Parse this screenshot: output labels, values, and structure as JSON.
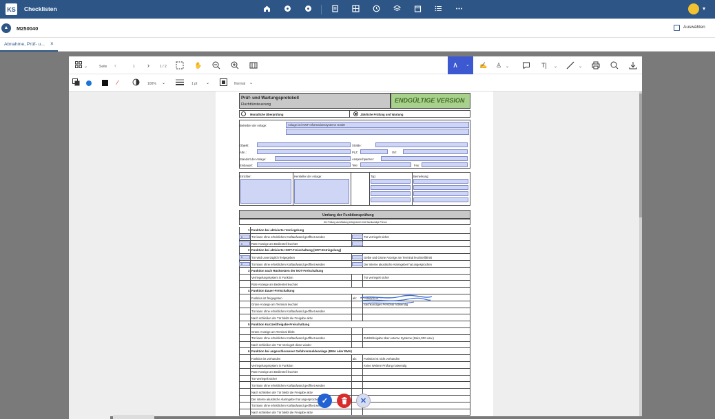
{
  "app": {
    "title": "Checklisten",
    "logo_text": "KS",
    "nav_icons": [
      "home-icon",
      "dot-icon",
      "dot-icon",
      "doc-icon",
      "grid-icon",
      "clock-icon",
      "layers-icon",
      "calendar-icon",
      "list-icon",
      "more-icon"
    ]
  },
  "record": {
    "id": "M250040",
    "select_label": "Auswählen"
  },
  "tabs": [
    {
      "label": "Abnahme, Prüf- u...",
      "close": "×"
    }
  ],
  "viewer": {
    "toolbar1": {
      "page_label": "Seite",
      "page_num": "1",
      "page_count": "1 / 2"
    },
    "toolbar2": {
      "zoom": "100%",
      "stroke": "1 pt",
      "blend": "Normal"
    }
  },
  "document": {
    "title": "Prüf- und Wartungsprotokoll",
    "subtitle": "Fluchttürsteuerung",
    "final_badge": "ENDGÜLTIGE VERSION",
    "check_monthly": "Monatliche Überprüfung",
    "check_yearly": "Jährliche Prüfung und Wartung",
    "operator_label": "Betreiber der Anlage:",
    "operator_value": "Anlage bei KWF Informationssysteme GmbH",
    "fields": {
      "object": "Objekt:",
      "street": "Straße:",
      "attn": "Attn.:",
      "zip": "PLZ:",
      "city": "Ort:",
      "location": "Standort der Anlage:",
      "contact": "Ansprechpartner:",
      "install": "Einbauort:",
      "phone": "Tele:",
      "fax": "Fax:",
      "installer": "Errichter:",
      "manufacturer": "Hersteller der Anlage:",
      "type": "Typ:",
      "remark": "Bemerkung:"
    },
    "section_title": "Umfang der Funktionsprüfung",
    "section_note": "Die Prüfung und Wartung erfolgt durch eine Sachkundige Person",
    "items": [
      {
        "num": "1",
        "title": "Funktion bei aktivierter Verriegelung"
      },
      {
        "text": "Tür kann ohne erheblichen Kraftaufwand geöffnet werden",
        "right": "Tür verriegelt sicher"
      },
      {
        "text": "Rote Anzeige am Bedienteil leuchtet"
      },
      {
        "num": "2",
        "title": "Funktion bei aktivierter NOT-Freischaltung (NOT-Entriegelung)"
      },
      {
        "text": "Tür wird unverzüglich freigegeben",
        "right": "Gelbe und Grüne Anzeige am Terminal leuchtet/blinkt"
      },
      {
        "text": "Tür kann ohne erheblichen Kraftaufwand geöffnet werden",
        "right": "Der interne akustische Alarmgeber hat angesprochen"
      },
      {
        "num": "3",
        "title": "Funktion nach Rücksetzen der NOT-Freischaltung"
      },
      {
        "text": "Verriegelungssystem in Funktion",
        "right": "Tür verriegelt sicher"
      },
      {
        "text": "Rote Anzeige am Bedienteil leuchtet"
      },
      {
        "num": "4",
        "title": "Funktion Dauer-Freischaltung"
      },
      {
        "text": "Funktion ist freigegeben",
        "mid": "ab:",
        "right": "Funktion ist ..."
      },
      {
        "text": "Grüne Anzeige am Terminal leuchtet",
        "right": "Sachkundiges Personal notwendig"
      },
      {
        "text": "Tür kann ohne erheblichen Kraftaufwand geöffnet werden"
      },
      {
        "text": "Nach schließen der Tür bleibt die Freigabe aktiv"
      },
      {
        "num": "5",
        "title": "Funktion Kurzzeitfreigabe-Freischaltung"
      },
      {
        "text": "Grüne Anzeige am Terminal blinkt"
      },
      {
        "text": "Tür kann ohne erheblichen Kraftaufwand geöffnet werden",
        "right": "Zutrittsfreigabe über externe Systeme (Zako,SPA usw.)"
      },
      {
        "text": "Nach schließen der Tür Verriegelt diese wieder"
      },
      {
        "num": "6",
        "title": "Funktion bei angeschlossener Gefahrenmeldeanlage (BMA oder EMA)"
      },
      {
        "text": "Funktion ist vorhanden",
        "mid": "ab:",
        "right": "Funktion ist nicht vorhanden"
      },
      {
        "text": "Verriegelungssystem in Funktion",
        "right": "Keine Weitere Prüfung notwendig"
      },
      {
        "text": "Rote Anzeige am Bedienteil leuchtet"
      },
      {
        "text": "Tür verriegelt sicher"
      },
      {
        "text": "Tür kann ohne erheblichen Kraftaufwand geöffnet werden"
      },
      {
        "text": "Nach schließen der Tür bleibt die Freigabe aktiv"
      },
      {
        "text": "Der interne akustische Alarmgeber hat angesprochen"
      },
      {
        "text": "Tür kann ohne erheblichen Kraftaufwand geöffnet werden"
      },
      {
        "text": "Nach schließen der Tür bleibt die Freigabe aktiv"
      }
    ],
    "dropdown_value": "0"
  },
  "actions": {
    "confirm": "✓",
    "delete": "🗑",
    "cancel": "✕"
  },
  "colors": {
    "brand": "#2d5686",
    "accent": "#3d59d1",
    "final": "#a9d18e",
    "field_fill": "#cfd5f4"
  }
}
